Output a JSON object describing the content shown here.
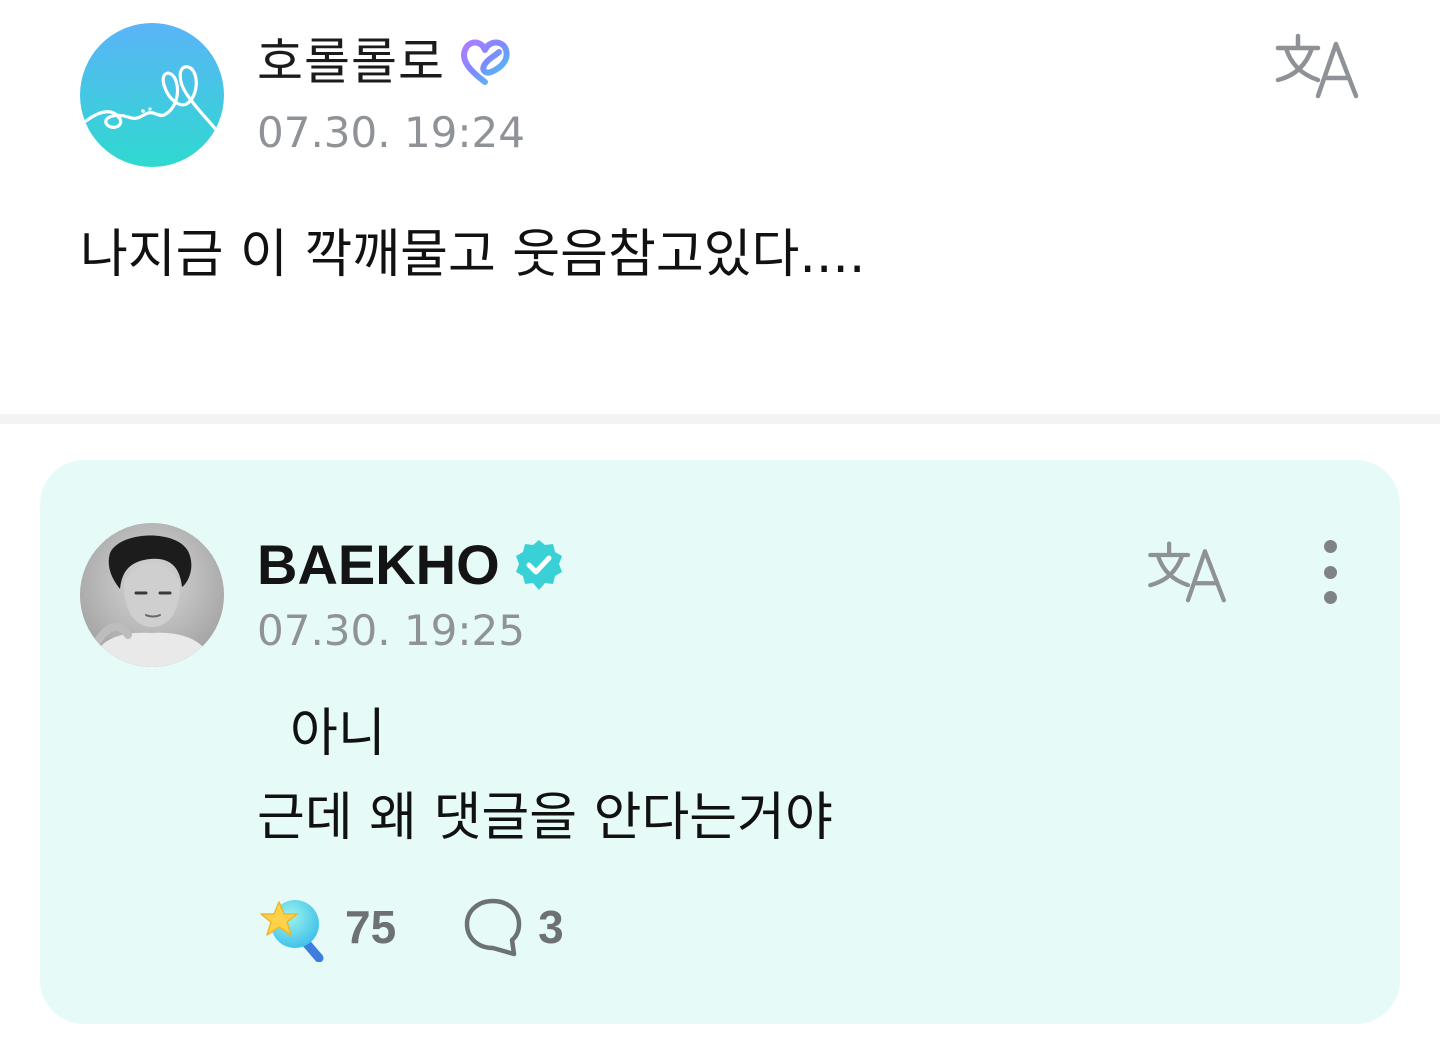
{
  "post": {
    "author": "호롤롤로",
    "timestamp": "07.30. 19:24",
    "body": "나지금 이 깍깨물고 웃음참고있다....",
    "author_badge_icon": "heart-badge-icon",
    "avatar_colors": [
      "#5ab4f7",
      "#2fd9d0"
    ]
  },
  "reply": {
    "author": "BAEKHO",
    "timestamp": "07.30. 19:25",
    "body": "  아니\n근데 왜 댓글을 안다는거야",
    "author_badge_icon": "verified-check-icon",
    "like_count": "75",
    "comment_count": "3",
    "card_color": "#e6fbf7",
    "badge_color": "#39d0d6"
  },
  "icons": {
    "translate": "translate-icon",
    "more": "more-vertical-icon",
    "like": "star-cheer-icon",
    "comment": "speech-bubble-icon"
  }
}
